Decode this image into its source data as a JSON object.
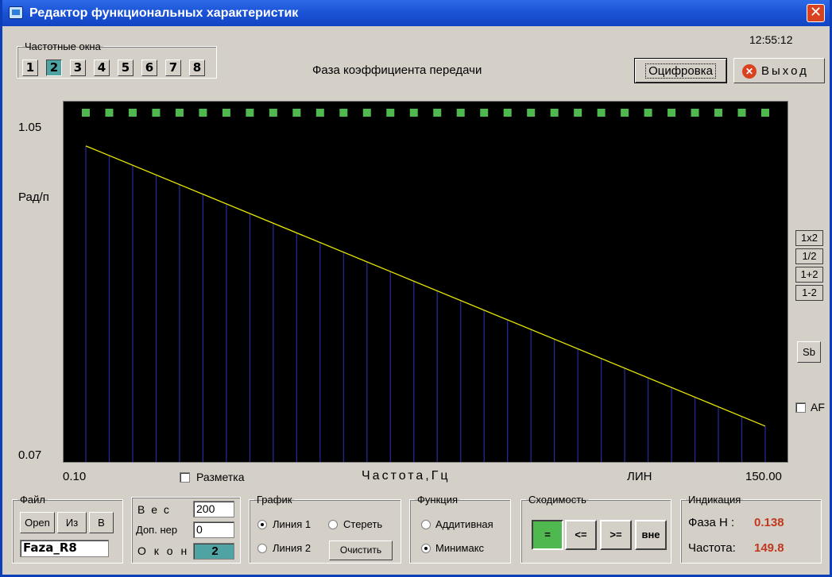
{
  "window": {
    "title": "Редактор функциональных характеристик",
    "close_glyph": "✕",
    "icon": "app-icon"
  },
  "freq_windows": {
    "legend": "Частотные окна",
    "tabs": [
      "1",
      "2",
      "3",
      "4",
      "5",
      "6",
      "7",
      "8"
    ],
    "active": "2"
  },
  "header": {
    "chart_title": "Фаза коэффициента передачи",
    "clock": "12:55:12",
    "digitize_label": "Оцифровка",
    "exit_label": "Выход",
    "exit_icon": "close-circle-icon"
  },
  "axes": {
    "y_top": "1.05",
    "y_unit": "Рад/п",
    "y_bottom": "0.07",
    "x_left": "0.10",
    "x_label": "Частота,Гц",
    "x_scale": "ЛИН",
    "x_right": "150.00",
    "grid_marks_label": "Разметка"
  },
  "chart_data": {
    "type": "line",
    "xlabel": "Частота,Гц",
    "ylabel": "Рад/п",
    "xlim": [
      0.1,
      150.0
    ],
    "ylim": [
      0.07,
      1.05
    ],
    "x_scale": "ЛИН",
    "series": [
      {
        "color": "#e8e800",
        "x": [
          0.1,
          150.0
        ],
        "y": [
          0.99,
          0.17
        ]
      }
    ],
    "markers_count": 30,
    "marker_color": "#4fb84f",
    "stem_count": 30,
    "stem_color": "#2a2aa0",
    "grid": false
  },
  "side_buttons": [
    "1x2",
    "1/2",
    "1+2",
    "1-2"
  ],
  "sb_label": "Sb",
  "af_label": "AF",
  "file_panel": {
    "legend": "Файл",
    "open": "Open",
    "from": "Из",
    "to": "В",
    "filename": "Faza_R8"
  },
  "weight_panel": {
    "weight_label": "В е с",
    "weight_value": "200",
    "extra_label": "Доп. нер",
    "extra_value": "0",
    "windows_label": "О к о н",
    "windows_value": "2"
  },
  "graph_panel": {
    "legend": "График",
    "line1": "Линия 1",
    "line2": "Линия 2",
    "erase": "Стереть",
    "clear": "Очистить"
  },
  "function_panel": {
    "legend": "Функция",
    "additive": "Аддитивная",
    "minimax": "Минимакс"
  },
  "convergence_panel": {
    "legend": "Сходимость",
    "eq": "=",
    "le": "<=",
    "ge": ">=",
    "out": "вне",
    "active_color": "#4fb84f"
  },
  "indication_panel": {
    "legend": "Индикация",
    "phase_label": "Фаза Н :",
    "phase_value": "0.138",
    "freq_label": "Частота:",
    "freq_value": "149.8"
  }
}
